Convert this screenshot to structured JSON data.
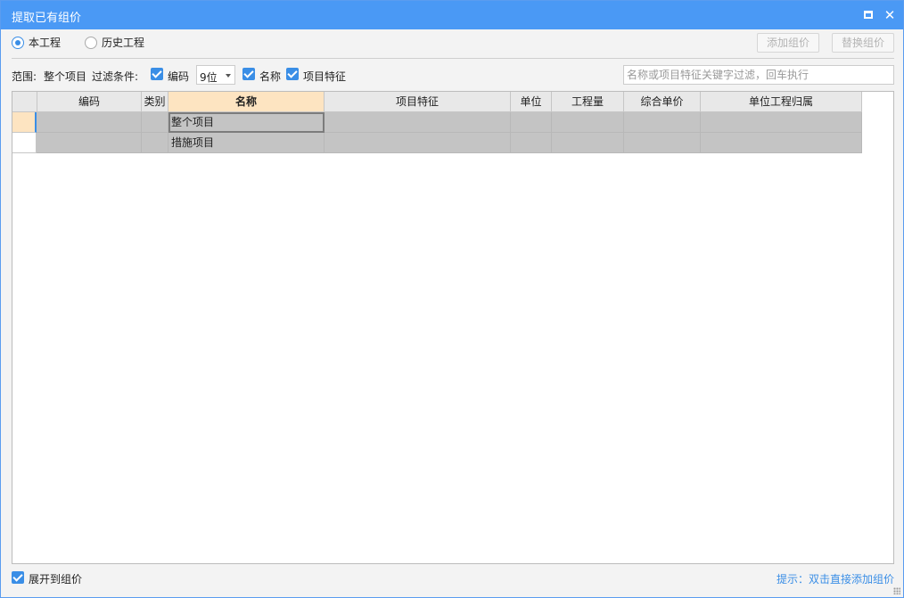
{
  "window": {
    "title": "提取已有组价"
  },
  "scope_radio": [
    {
      "label": "本工程",
      "selected": true
    },
    {
      "label": "历史工程",
      "selected": false
    }
  ],
  "buttons": {
    "add": "添加组价",
    "replace": "替换组价"
  },
  "filter": {
    "scope_label": "范围:",
    "scope_value": "整个项目",
    "conditions_label": "过滤条件:",
    "code_label": "编码",
    "code_checked": true,
    "digits_value": "9位",
    "name_label": "名称",
    "name_checked": true,
    "feature_label": "项目特征",
    "feature_checked": true,
    "search_placeholder": "名称或项目特征关键字过滤，回车执行"
  },
  "table": {
    "columns": [
      "编码",
      "类别",
      "名称",
      "项目特征",
      "单位",
      "工程量",
      "综合单价",
      "单位工程归属"
    ],
    "active_column": "名称",
    "rows": [
      {
        "code": "",
        "type": "",
        "name": "整个项目",
        "feature": "",
        "unit": "",
        "qty": "",
        "price": "",
        "belong": ""
      },
      {
        "code": "",
        "type": "",
        "name": "措施项目",
        "feature": "",
        "unit": "",
        "qty": "",
        "price": "",
        "belong": ""
      }
    ]
  },
  "footer": {
    "expand_label": "展开到组价",
    "expand_checked": true,
    "hint": "提示：双击直接添加组价"
  },
  "colors": {
    "titlebar": "#4a99f5",
    "accent": "#3a8ee6",
    "active_header": "#fde4c1",
    "row_fill": "#c4c4c4"
  }
}
